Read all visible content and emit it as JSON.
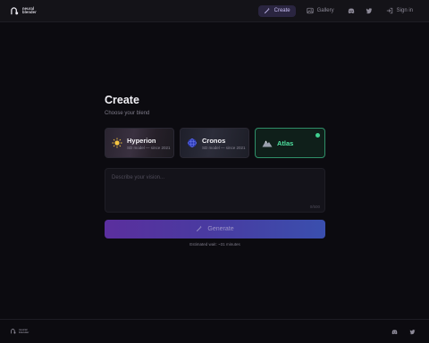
{
  "header": {
    "logo_line1": "neural",
    "logo_line2": "blender",
    "nav": {
      "create": "Create",
      "gallery": "Gallery",
      "signin": "Sign in"
    }
  },
  "main": {
    "title": "Create",
    "subtitle": "Choose your blend",
    "cards": [
      {
        "name": "Hyperion",
        "meta": "SD model — since 2021",
        "selected": false
      },
      {
        "name": "Cronos",
        "meta": "SD model — since 2021",
        "selected": false
      },
      {
        "name": "Atlas",
        "meta": "",
        "selected": true
      }
    ],
    "prompt": {
      "placeholder": "Describe your vision...",
      "char_count": "0/500"
    },
    "generate_label": "Generate",
    "estimate": "Estimated wait: ~31 minutes"
  },
  "footer": {
    "logo_line1": "neural",
    "logo_line2": "blender"
  },
  "colors": {
    "background": "#0c0b10",
    "accent_purple": "#5b2f9e",
    "accent_blue": "#3a4fae",
    "selected_green": "#4fe0a0"
  }
}
